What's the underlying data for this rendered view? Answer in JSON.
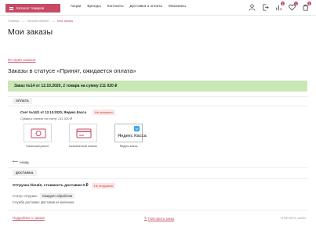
{
  "header": {
    "catalog_label": "Каталог товаров",
    "nav": [
      "Акции",
      "Бренды",
      "Контакты",
      "Доставка и оплата",
      "Магазины"
    ],
    "compare_count": "1",
    "favorites_count": "1",
    "cart_count": "1"
  },
  "breadcrumb": {
    "items": [
      "Главная",
      "Личный кабинет",
      "Мои заказы"
    ],
    "separator": "—"
  },
  "page_title": "Мои заказы",
  "history_link": "История заказов",
  "status_heading": "Заказы в статусе «Принят, ожидается оплата»",
  "order_banner": "Заказ №14 от 12.10.2020, 2 товара на сумму 211 020 ₽",
  "payment": {
    "section_label": "ОПЛАТА",
    "invoice_title": "Счет №14/1 от 12.10.2020, Яндекс.Касса",
    "status": "Не оплачено",
    "sum_text": "Сумма к оплате по счету: 211 020 ₽",
    "methods": [
      "Наличный расчет",
      "Безналичный платеж",
      "Яндекс.Касса"
    ],
    "yandex_logo": "Яндекс Касса"
  },
  "back_link": "назад",
  "delivery": {
    "section_label": "ДОСТАВКА",
    "shipment_title": "Отгрузка №14/2, стоимость доставки 0 ₽",
    "shipment_status": "Не отгружено",
    "status_label": "Статус отгрузки:",
    "status_value": "Ожидает обработки",
    "service_text": "Служба доставки: Доставка из магазина"
  },
  "footer": {
    "details_link": "Подробнее о заказе",
    "repeat_link": "Повторить заказ",
    "cancel_link": "Отменить заказ"
  },
  "colors": {
    "accent": "#c74a63",
    "banner": "#c8e7b5",
    "yandex_badge": "#3fa9f5"
  }
}
